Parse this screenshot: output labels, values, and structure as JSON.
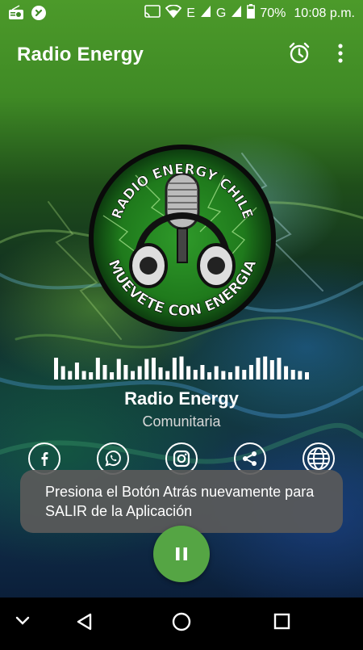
{
  "status_bar": {
    "network_e1": "E",
    "network_g": "G",
    "battery": "70%",
    "time": "10:08 p.m."
  },
  "app_bar": {
    "title": "Radio Energy",
    "alarm_icon": "alarm-clock-icon",
    "more_icon": "more-vert-icon"
  },
  "logo": {
    "top_text": "RADIO ENERGY CHILE",
    "bottom_text": "MUEVETE CON ENERGIA"
  },
  "equalizer": {
    "levels": [
      0.9,
      0.55,
      0.35,
      0.7,
      0.35,
      0.3,
      0.9,
      0.6,
      0.3,
      0.85,
      0.6,
      0.35,
      0.55,
      0.85,
      0.9,
      0.5,
      0.35,
      0.9,
      0.95,
      0.55,
      0.4,
      0.6,
      0.3,
      0.55,
      0.35,
      0.3,
      0.55,
      0.4,
      0.6,
      0.9,
      0.95,
      0.8,
      0.9,
      0.55,
      0.4,
      0.35,
      0.3
    ]
  },
  "station": {
    "name": "Radio Energy",
    "genre": "Comunitaria"
  },
  "social": [
    {
      "icon": "facebook-icon"
    },
    {
      "icon": "whatsapp-icon"
    },
    {
      "icon": "instagram-icon"
    },
    {
      "icon": "share-icon"
    },
    {
      "icon": "globe-icon"
    }
  ],
  "toast": {
    "message": "Presiona el Botón Atrás nuevamente para SALIR de la Aplicación"
  },
  "player": {
    "state_icon": "pause-icon"
  },
  "navigation": {
    "buttons": [
      "chevron-down-icon",
      "back-icon",
      "home-icon",
      "recents-icon"
    ]
  },
  "colors": {
    "accent": "#55a544",
    "toast_bg": "#5a5a5a"
  }
}
